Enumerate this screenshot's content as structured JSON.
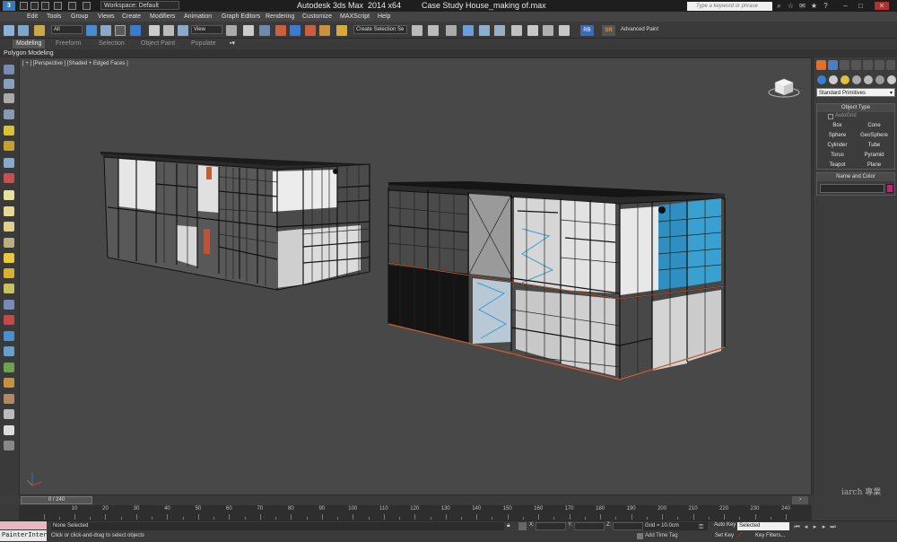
{
  "titlebar": {
    "logo": "3",
    "workspace": "Workspace: Default",
    "title": "Autodesk 3ds Max  2014 x64",
    "document": "Case Study House_making of.max",
    "search_placeholder": "Type a keyword or phrase"
  },
  "menu": [
    "Edit",
    "Tools",
    "Group",
    "Views",
    "Create",
    "Modifiers",
    "Animation",
    "Graph Editors",
    "Rendering",
    "Customize",
    "MAXScript",
    "Help"
  ],
  "toolbar": {
    "filter_value": "All",
    "refcoord_value": "View",
    "selection_set_value": "Create Selection Se",
    "rb_label": "RB",
    "sr_label": "SR",
    "advanced_paint": "Advanced Paint"
  },
  "ribbon": {
    "tabs": [
      "Modeling",
      "Freeform",
      "Selection",
      "Object Paint",
      "Populate"
    ],
    "sub_label": "Polygon Modeling"
  },
  "viewport": {
    "label": "[ + ] [Perspective ] [Shaded + Edged Faces ]"
  },
  "command_panel": {
    "primitives_dropdown": "Standard Primitives",
    "object_type_header": "Object Type",
    "autogrid": "AutoGrid",
    "buttons": [
      "Box",
      "Cone",
      "Sphere",
      "GeoSphere",
      "Cylinder",
      "Tube",
      "Torus",
      "Pyramid",
      "Teapot",
      "Plane"
    ],
    "name_color_header": "Name and Color",
    "object_color": "#c8207a"
  },
  "timeline": {
    "frame_indicator": "0 / 240",
    "ticks": [
      "10",
      "20",
      "30",
      "40",
      "50",
      "60",
      "70",
      "80",
      "90",
      "100",
      "110",
      "120",
      "130",
      "140",
      "150",
      "160",
      "170",
      "180",
      "190",
      "200",
      "210",
      "220",
      "230",
      "240"
    ]
  },
  "status": {
    "painter": "PainterInter",
    "selection": "None Selected",
    "hint": "Click or click-and-drag to select objects",
    "x_label": "X:",
    "y_label": "Y:",
    "z_label": "Z:",
    "grid": "Grid = 10.0cm",
    "add_time_tag": "Add Time Tag",
    "auto_key": "Auto Key",
    "selected_dd": "Selected",
    "set_key": "Set Key",
    "key_filters": "Key Filters..."
  },
  "watermark": "iarch 專業"
}
